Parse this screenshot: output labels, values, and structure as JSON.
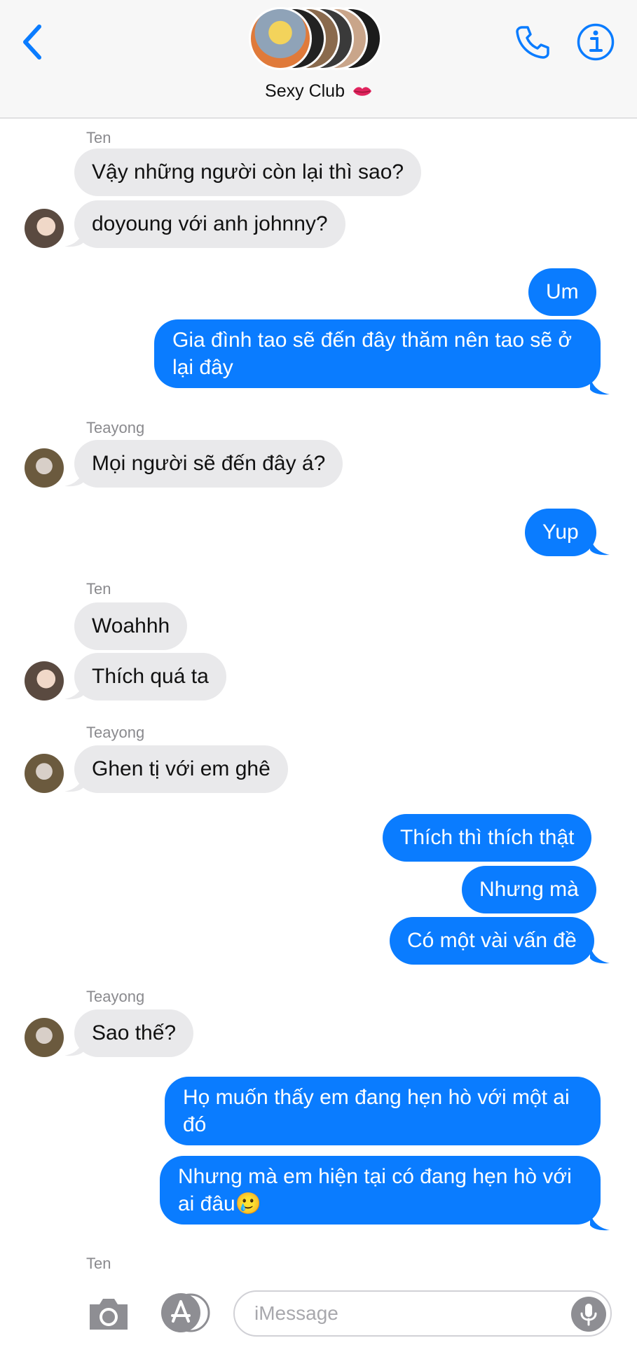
{
  "header": {
    "group_name": "Sexy Club",
    "back_icon": "chevron-left-icon",
    "call_icon": "phone-icon",
    "info_icon": "info-icon",
    "accent_color": "#0a7cff"
  },
  "messages": [
    {
      "sender": "Ten",
      "text": "Vậy những người còn lại thì sao?"
    },
    {
      "text": "doyoung với anh johnny?"
    },
    {
      "text": "Um"
    },
    {
      "text": "Gia đình tao sẽ đến đây thăm nên tao sẽ ở lại đây"
    },
    {
      "sender": "Teayong",
      "text": "Mọi người sẽ đến đây á?"
    },
    {
      "text": "Yup"
    },
    {
      "sender": "Ten",
      "text": "Woahhh"
    },
    {
      "text": "Thích quá ta"
    },
    {
      "sender": "Teayong",
      "text": "Ghen tị với em ghê"
    },
    {
      "text": "Thích thì thích thật"
    },
    {
      "text": "Nhưng mà"
    },
    {
      "text": "Có một vài vấn đề"
    },
    {
      "sender": "Teayong",
      "text": "Sao thế?"
    },
    {
      "text": "Họ muốn thấy em đang hẹn hò với một ai đó"
    },
    {
      "text": "Nhưng mà em hiện tại có đang hẹn hò với ai đâu🥲"
    },
    {
      "sender": "Ten"
    }
  ],
  "composer": {
    "placeholder": "iMessage",
    "camera_icon": "camera-icon",
    "apps_icon": "app-store-icon",
    "mic_icon": "microphone-icon"
  }
}
